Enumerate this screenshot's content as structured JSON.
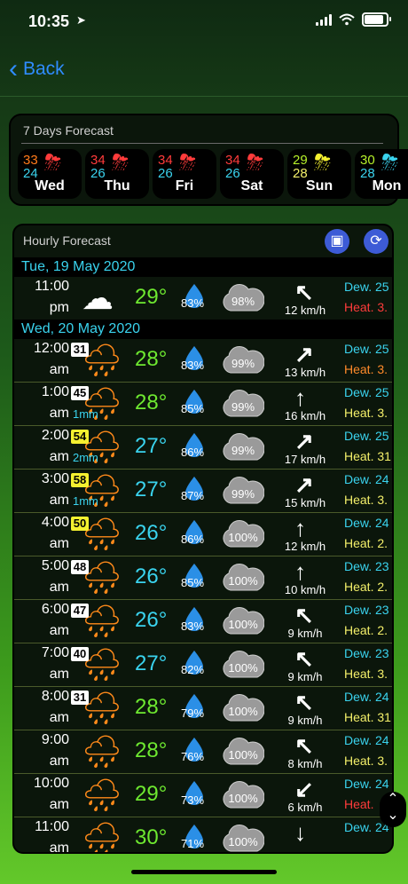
{
  "status": {
    "time": "10:35",
    "location_icon": "location-arrow-icon"
  },
  "nav": {
    "back_label": "Back"
  },
  "seven_day": {
    "title": "7 Days Forecast",
    "days": [
      {
        "hi": "33",
        "lo": "24",
        "name": "Wed",
        "icon": "rain-cloud-icon",
        "hi_color": "#ff7a1a",
        "lo_color": "#3ad3ee",
        "icon_color": "#ff3b3b"
      },
      {
        "hi": "34",
        "lo": "26",
        "name": "Thu",
        "icon": "rain-cloud-icon",
        "hi_color": "#ff3b3b",
        "lo_color": "#3ad3ee",
        "icon_color": "#ff3b3b"
      },
      {
        "hi": "34",
        "lo": "26",
        "name": "Fri",
        "icon": "rain-cloud-icon",
        "hi_color": "#ff3b3b",
        "lo_color": "#3ad3ee",
        "icon_color": "#ff3b3b"
      },
      {
        "hi": "34",
        "lo": "26",
        "name": "Sat",
        "icon": "rain-cloud-icon",
        "hi_color": "#ff3b3b",
        "lo_color": "#3ad3ee",
        "icon_color": "#ff3b3b"
      },
      {
        "hi": "29",
        "lo": "28",
        "name": "Sun",
        "icon": "rain-cloud-icon",
        "hi_color": "#b6f02a",
        "lo_color": "#f4f06a",
        "icon_color": "#f4f030"
      },
      {
        "hi": "30",
        "lo": "28",
        "name": "Mon",
        "icon": "rain-cloud-icon",
        "hi_color": "#b6f02a",
        "lo_color": "#3ad3ee",
        "icon_color": "#3ad3ee"
      }
    ]
  },
  "hourly": {
    "title": "Hourly Forecast",
    "dates": [
      "Tue, 19 May 2020",
      "Wed, 20 May 2020"
    ],
    "rows": [
      {
        "t1": "11:00",
        "t2": "pm",
        "uv": "",
        "uv_color": "",
        "rain": "",
        "temp": "29°",
        "temp_color": "#6ee830",
        "hum": "83%",
        "cloud": "98%",
        "arrow": "↖",
        "wind": "12 km/h",
        "dew": "Dew. 25",
        "heat": "Heat. 3.",
        "heat_color": "#ff3b3b",
        "icon_color": "#ffffff"
      },
      {
        "t1": "12:00",
        "t2": "am",
        "uv": "31",
        "uv_color": "#ffffff",
        "rain": "",
        "temp": "28°",
        "temp_color": "#6ee830",
        "hum": "83%",
        "cloud": "99%",
        "arrow": "↗",
        "wind": "13 km/h",
        "dew": "Dew. 25",
        "heat": "Heat. 3.",
        "heat_color": "#ff8a2a",
        "icon_color": "#ff8a1a"
      },
      {
        "t1": "1:00",
        "t2": "am",
        "uv": "45",
        "uv_color": "#ffffff",
        "rain": "1mm",
        "temp": "28°",
        "temp_color": "#6ee830",
        "hum": "85%",
        "cloud": "99%",
        "arrow": "↑",
        "wind": "16 km/h",
        "dew": "Dew. 25",
        "heat": "Heat. 3.",
        "heat_color": "#f4f06a",
        "icon_color": "#ff8a1a"
      },
      {
        "t1": "2:00",
        "t2": "am",
        "uv": "54",
        "uv_color": "#f4f030",
        "rain": "2mm",
        "temp": "27°",
        "temp_color": "#3ad3ee",
        "hum": "86%",
        "cloud": "99%",
        "arrow": "↗",
        "wind": "17 km/h",
        "dew": "Dew. 25",
        "heat": "Heat. 31",
        "heat_color": "#f4f06a",
        "icon_color": "#ff8a1a"
      },
      {
        "t1": "3:00",
        "t2": "am",
        "uv": "58",
        "uv_color": "#f4f030",
        "rain": "1mm",
        "temp": "27°",
        "temp_color": "#3ad3ee",
        "hum": "87%",
        "cloud": "99%",
        "arrow": "↗",
        "wind": "15 km/h",
        "dew": "Dew. 24",
        "heat": "Heat. 3.",
        "heat_color": "#f4f06a",
        "icon_color": "#ff8a1a"
      },
      {
        "t1": "4:00",
        "t2": "am",
        "uv": "50",
        "uv_color": "#f4f030",
        "rain": "",
        "temp": "26°",
        "temp_color": "#3ad3ee",
        "hum": "86%",
        "cloud": "100%",
        "arrow": "↑",
        "wind": "12 km/h",
        "dew": "Dew. 24",
        "heat": "Heat. 2.",
        "heat_color": "#f4f06a",
        "icon_color": "#ff8a1a"
      },
      {
        "t1": "5:00",
        "t2": "am",
        "uv": "48",
        "uv_color": "#ffffff",
        "rain": "",
        "temp": "26°",
        "temp_color": "#3ad3ee",
        "hum": "85%",
        "cloud": "100%",
        "arrow": "↑",
        "wind": "10 km/h",
        "dew": "Dew. 23",
        "heat": "Heat. 2.",
        "heat_color": "#f4f06a",
        "icon_color": "#ff8a1a"
      },
      {
        "t1": "6:00",
        "t2": "am",
        "uv": "47",
        "uv_color": "#ffffff",
        "rain": "",
        "temp": "26°",
        "temp_color": "#3ad3ee",
        "hum": "83%",
        "cloud": "100%",
        "arrow": "↖",
        "wind": "9 km/h",
        "dew": "Dew. 23",
        "heat": "Heat. 2.",
        "heat_color": "#f4f06a",
        "icon_color": "#ff8a1a"
      },
      {
        "t1": "7:00",
        "t2": "am",
        "uv": "40",
        "uv_color": "#ffffff",
        "rain": "",
        "temp": "27°",
        "temp_color": "#3ad3ee",
        "hum": "82%",
        "cloud": "100%",
        "arrow": "↖",
        "wind": "9 km/h",
        "dew": "Dew. 23",
        "heat": "Heat. 3.",
        "heat_color": "#f4f06a",
        "icon_color": "#ff8a1a"
      },
      {
        "t1": "8:00",
        "t2": "am",
        "uv": "31",
        "uv_color": "#ffffff",
        "rain": "",
        "temp": "28°",
        "temp_color": "#6ee830",
        "hum": "79%",
        "cloud": "100%",
        "arrow": "↖",
        "wind": "9 km/h",
        "dew": "Dew. 24",
        "heat": "Heat. 31",
        "heat_color": "#f4f06a",
        "icon_color": "#ff8a1a"
      },
      {
        "t1": "9:00",
        "t2": "am",
        "uv": "",
        "uv_color": "",
        "rain": "",
        "temp": "28°",
        "temp_color": "#6ee830",
        "hum": "76%",
        "cloud": "100%",
        "arrow": "↖",
        "wind": "8 km/h",
        "dew": "Dew. 24",
        "heat": "Heat. 3.",
        "heat_color": "#f4f06a",
        "icon_color": "#ff8a1a"
      },
      {
        "t1": "10:00",
        "t2": "am",
        "uv": "",
        "uv_color": "",
        "rain": "",
        "temp": "29°",
        "temp_color": "#6ee830",
        "hum": "73%",
        "cloud": "100%",
        "arrow": "↙",
        "wind": "6 km/h",
        "dew": "Dew. 24",
        "heat": "Heat.",
        "heat_color": "#ff3b3b",
        "icon_color": "#ff8a1a"
      },
      {
        "t1": "11:00",
        "t2": "am",
        "uv": "",
        "uv_color": "",
        "rain": "",
        "temp": "30°",
        "temp_color": "#6ee830",
        "hum": "71%",
        "cloud": "100%",
        "arrow": "↓",
        "wind": "",
        "dew": "Dew. 24",
        "heat": "",
        "heat_color": "#ff3b3b",
        "icon_color": "#ff8a1a"
      }
    ]
  }
}
